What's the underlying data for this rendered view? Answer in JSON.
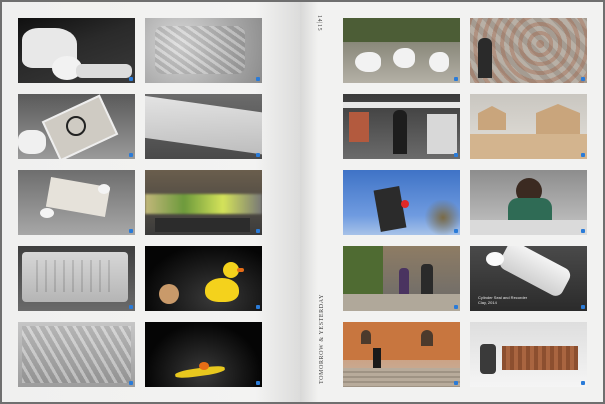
{
  "folio": "14|15",
  "running_title": "TOMORROW & YESTERDAY",
  "left_page": {
    "photos": [
      {
        "subject": "hand unrolling clay cylinder"
      },
      {
        "subject": "clay impression texture"
      },
      {
        "subject": "hand holding cut box"
      },
      {
        "subject": "clay slab edge"
      },
      {
        "subject": "unrolled scroll and caps"
      },
      {
        "subject": "runners on treadmill"
      },
      {
        "subject": "cylinder seal impression"
      },
      {
        "subject": "rubber duck and egg"
      },
      {
        "subject": "relief pattern"
      },
      {
        "subject": "broken duck on floor"
      }
    ]
  },
  "right_page": {
    "photos": [
      {
        "subject": "geese on steps"
      },
      {
        "subject": "woman at mosaic wall"
      },
      {
        "subject": "subway station gates"
      },
      {
        "subject": "clay house models"
      },
      {
        "subject": "traffic light and sky"
      },
      {
        "subject": "woman at table"
      },
      {
        "subject": "people walking on street"
      },
      {
        "subject": "white cylinder seal",
        "caption_lines": [
          "Cylinder Seal and Recorder",
          "Clay, 2014"
        ]
      },
      {
        "subject": "man on church steps"
      },
      {
        "subject": "seal with impression"
      }
    ]
  },
  "colors": {
    "marker": "#2a7bd8",
    "page": "#f1f1f0",
    "background": "#6f6f6f"
  }
}
